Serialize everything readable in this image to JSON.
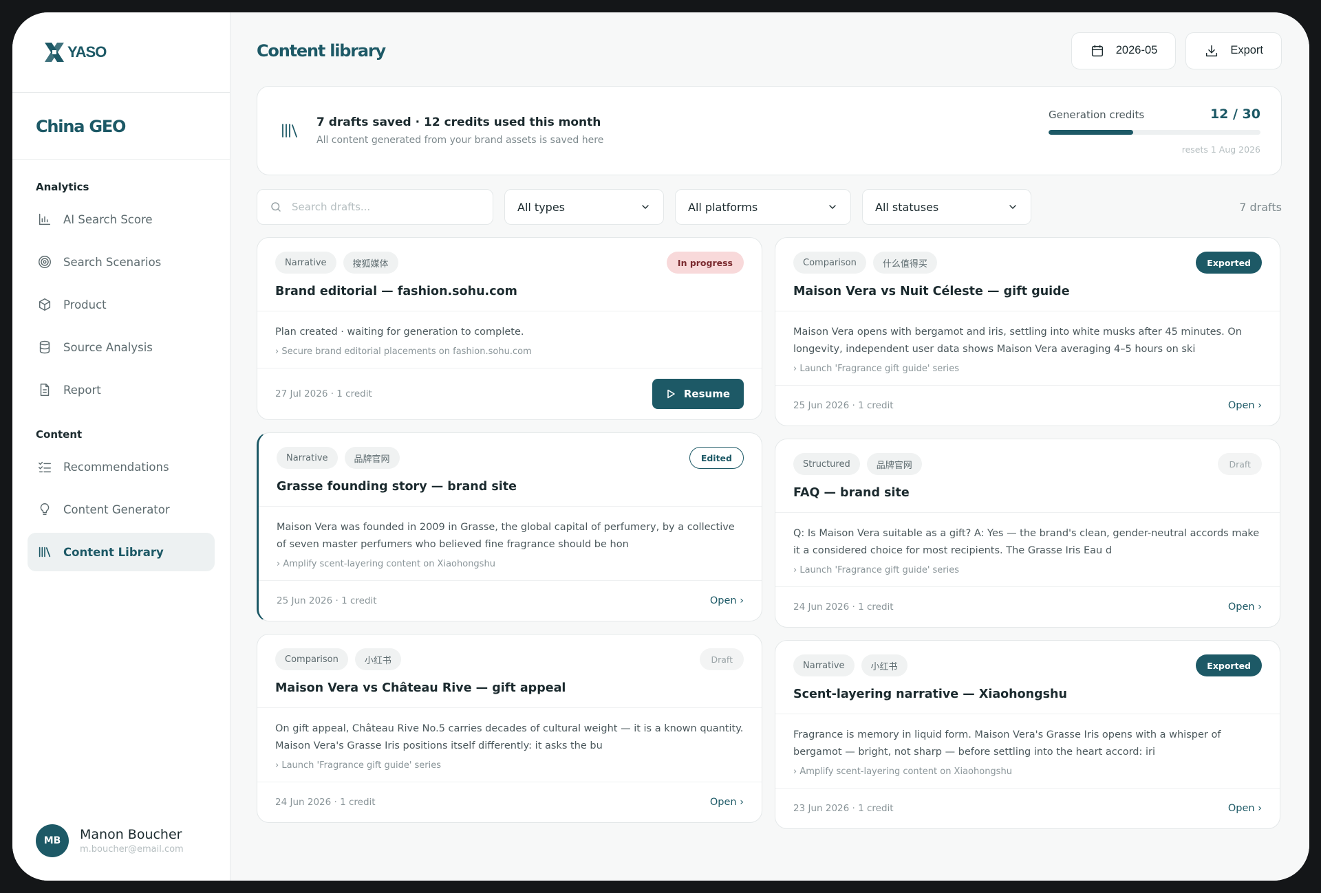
{
  "brand": {
    "logo_text": "YASO",
    "workspace": "China GEO"
  },
  "colors": {
    "accent": "#1d5966",
    "progress_bg": "#f8d9da",
    "muted": "#8a9599"
  },
  "sidebar": {
    "analytics_heading": "Analytics",
    "analytics_items": [
      {
        "label": "AI Search Score",
        "icon": "bar-chart-icon"
      },
      {
        "label": "Search Scenarios",
        "icon": "target-icon"
      },
      {
        "label": "Product",
        "icon": "box-icon"
      },
      {
        "label": "Source Analysis",
        "icon": "database-icon"
      },
      {
        "label": "Report",
        "icon": "document-icon"
      }
    ],
    "content_heading": "Content",
    "content_items": [
      {
        "label": "Recommendations",
        "icon": "checklist-icon"
      },
      {
        "label": "Content Generator",
        "icon": "lightbulb-icon"
      },
      {
        "label": "Content Library",
        "icon": "library-icon",
        "active": true
      }
    ],
    "user": {
      "initials": "MB",
      "name": "Manon Boucher",
      "email": "m.boucher@email.com"
    }
  },
  "header": {
    "title": "Content library",
    "date": "2026-05",
    "export_label": "Export"
  },
  "summary": {
    "title": "7 drafts saved · 12 credits used this month",
    "subtitle": "All content generated from your brand assets is saved here",
    "credits_label": "Generation credits",
    "credits_value": "12 / 30",
    "credits_used": 12,
    "credits_total": 30,
    "reset_text": "resets 1 Aug 2026"
  },
  "filters": {
    "search_placeholder": "Search drafts...",
    "type": "All types",
    "platform": "All platforms",
    "status": "All statuses",
    "count": "7 drafts"
  },
  "cards": [
    {
      "tags": [
        "Narrative",
        "搜狐媒体"
      ],
      "status": "In progress",
      "title": "Brand editorial — fashion.sohu.com",
      "text": "Plan created · waiting for generation to complete.",
      "meta": "› Secure brand editorial placements on fashion.sohu.com",
      "date": "27 Jul 2026 · 1 credit",
      "action": "Resume"
    },
    {
      "tags": [
        "Comparison",
        "什么值得买"
      ],
      "status": "Exported",
      "title": "Maison Vera vs Nuit Céleste — gift guide",
      "text": "Maison Vera opens with bergamot and iris, settling into white musks after 45 minutes. On longevity, independent user data shows Maison Vera averaging 4–5 hours on ski",
      "meta": "› Launch 'Fragrance gift guide' series",
      "date": "25 Jun 2026 · 1 credit",
      "action": "Open ›"
    },
    {
      "tags": [
        "Narrative",
        "品牌官网"
      ],
      "status": "Edited",
      "title": "Grasse founding story — brand site",
      "text": "Maison Vera was founded in 2009 in Grasse, the global capital of perfumery, by a collective of seven master perfumers who believed fine fragrance should be hon",
      "meta": "› Amplify scent-layering content on Xiaohongshu",
      "date": "25 Jun 2026 · 1 credit",
      "action": "Open ›"
    },
    {
      "tags": [
        "Structured",
        "品牌官网"
      ],
      "status": "Draft",
      "title": "FAQ — brand site",
      "text": "Q: Is Maison Vera suitable as a gift? A: Yes — the brand's clean, gender-neutral accords make it a considered choice for most recipients. The Grasse Iris Eau d",
      "meta": "› Launch 'Fragrance gift guide' series",
      "date": "24 Jun 2026 · 1 credit",
      "action": "Open ›"
    },
    {
      "tags": [
        "Comparison",
        "小红书"
      ],
      "status": "Draft",
      "title": "Maison Vera vs Château Rive — gift appeal",
      "text": "On gift appeal, Château Rive No.5 carries decades of cultural weight — it is a known quantity. Maison Vera's Grasse Iris positions itself differently: it asks the bu",
      "meta": "› Launch 'Fragrance gift guide' series",
      "date": "24 Jun 2026 · 1 credit",
      "action": "Open ›"
    },
    {
      "tags": [
        "Narrative",
        "小红书"
      ],
      "status": "Exported",
      "title": "Scent-layering narrative — Xiaohongshu",
      "text": "Fragrance is memory in liquid form. Maison Vera's Grasse Iris opens with a whisper of bergamot — bright, not sharp — before settling into the heart accord: iri",
      "meta": "› Amplify scent-layering content on Xiaohongshu",
      "date": "23 Jun 2026 · 1 credit",
      "action": "Open ›"
    }
  ]
}
